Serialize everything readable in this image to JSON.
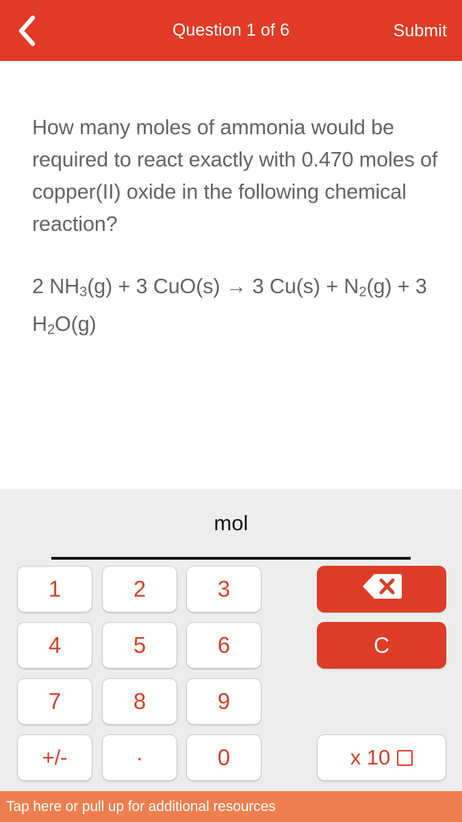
{
  "header": {
    "back_icon": "chevron-left-icon",
    "title": "Question 1 of 6",
    "submit_label": "Submit",
    "background_color": "#E03B26"
  },
  "question": {
    "prompt": "How many moles of ammonia would be required to react exactly with 0.470 moles of copper(II) oxide in the following chemical reaction?",
    "equation_plain": "2 NH3(g) + 3 CuO(s) → 3 Cu(s) + N2(g) + 3 H2O(g)",
    "equation_parts": [
      {
        "text": "2 NH"
      },
      {
        "sub": "3"
      },
      {
        "text": "(g) + 3 CuO(s) → 3 Cu(s) + N"
      },
      {
        "sub": "2"
      },
      {
        "text": "(g) + 3 H"
      },
      {
        "sub": "2"
      },
      {
        "text": "O(g)"
      }
    ],
    "text_color": "#636363"
  },
  "answer": {
    "unit_label": "mol",
    "value": "",
    "placeholder": ""
  },
  "keypad": {
    "background_color": "#EDEDED",
    "digit_color": "#D3402A",
    "action_color": "#DF3C27",
    "keys": [
      {
        "label": "1",
        "name": "key-1"
      },
      {
        "label": "2",
        "name": "key-2"
      },
      {
        "label": "3",
        "name": "key-3"
      },
      {
        "label": "4",
        "name": "key-4"
      },
      {
        "label": "5",
        "name": "key-5"
      },
      {
        "label": "6",
        "name": "key-6"
      },
      {
        "label": "7",
        "name": "key-7"
      },
      {
        "label": "8",
        "name": "key-8"
      },
      {
        "label": "9",
        "name": "key-9"
      },
      {
        "label": "+/-",
        "name": "key-sign"
      },
      {
        "label": ".",
        "name": "key-decimal"
      },
      {
        "label": "0",
        "name": "key-0"
      }
    ],
    "backspace_icon": "backspace-icon",
    "clear_label": "C",
    "exponent_label": "x 10"
  },
  "bottom_bar": {
    "text": "Tap here or pull up for additional resources",
    "background_color": "#EE7E4E"
  }
}
